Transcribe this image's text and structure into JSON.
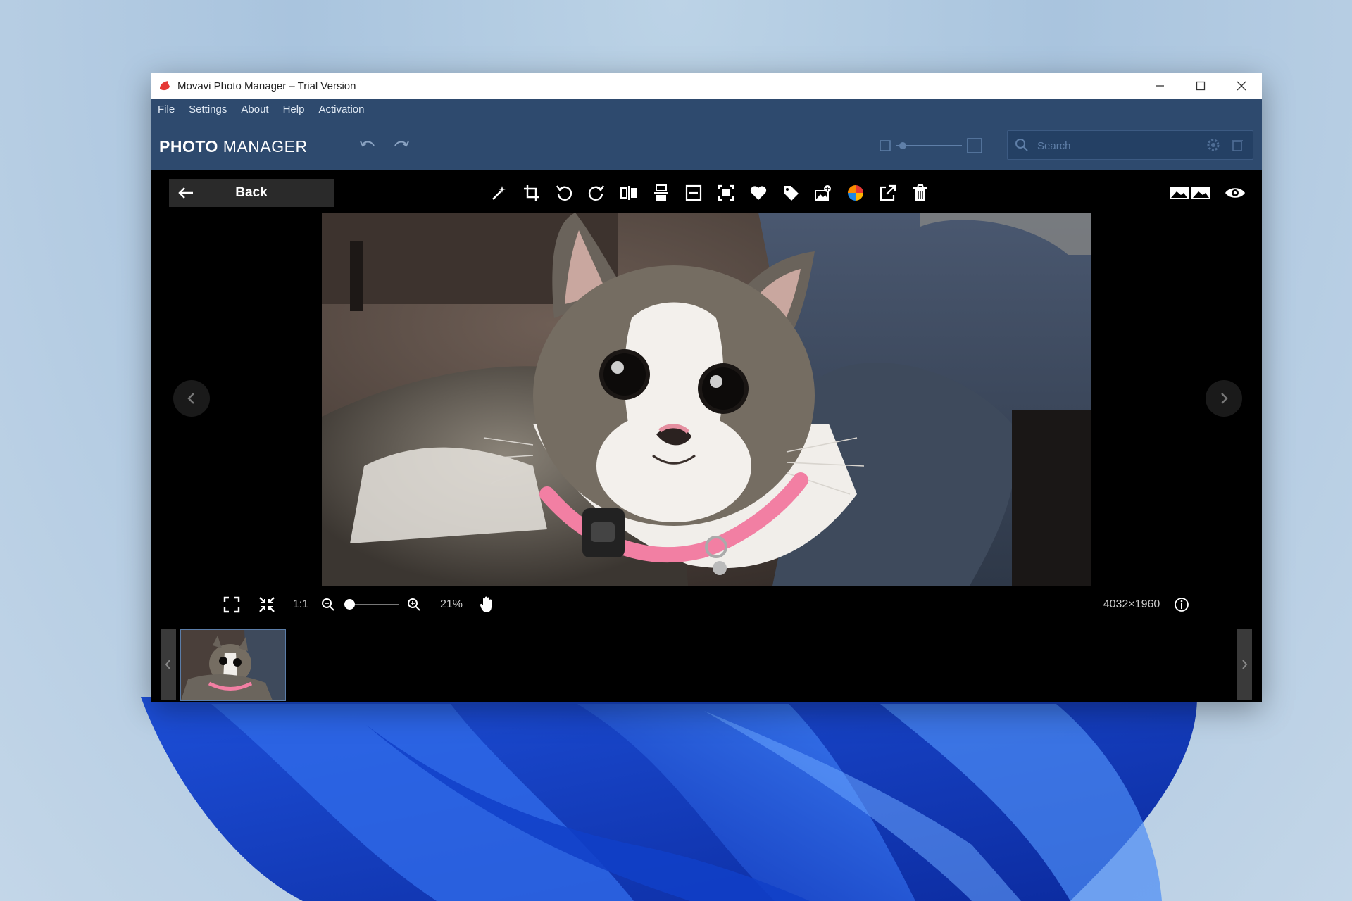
{
  "window": {
    "title": "Movavi Photo Manager – Trial Version"
  },
  "menu": [
    "File",
    "Settings",
    "About",
    "Help",
    "Activation"
  ],
  "header": {
    "brand_bold": "PHOTO",
    "brand_light": "MANAGER",
    "search_placeholder": "Search"
  },
  "viewer": {
    "back_label": "Back",
    "tools": [
      "magic-wand-icon",
      "crop-icon",
      "rotate-left-icon",
      "rotate-right-icon",
      "flip-horizontal-icon",
      "flip-vertical-icon",
      "straighten-icon",
      "resize-icon",
      "heart-icon",
      "tag-icon",
      "add-album-icon",
      "color-palette-icon",
      "share-icon",
      "trash-icon"
    ],
    "bottom": {
      "one_to_one": "1:1",
      "zoom_percent": "21%",
      "zoom_level": 0.21,
      "dimensions": "4032×1960"
    }
  },
  "colors": {
    "menu_bg": "#2e4a6e",
    "viewer_bg": "#000000",
    "accent": "#5b7da8"
  }
}
